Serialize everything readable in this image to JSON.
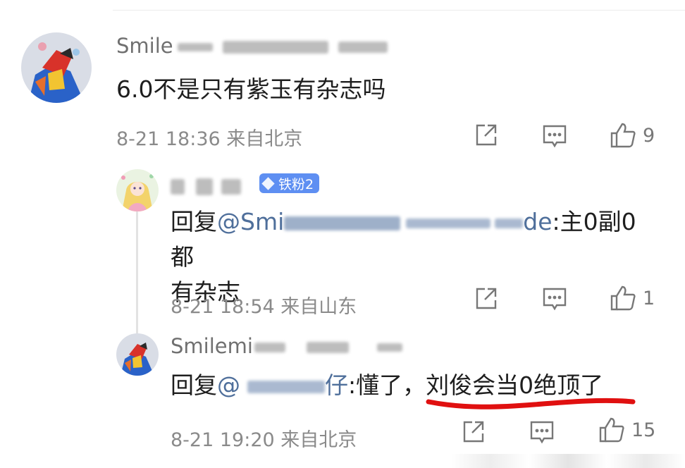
{
  "comment": {
    "author": "Smile",
    "text": "6.0不是只有紫玉有杂志吗",
    "meta": "8-21 18:36 来自北京",
    "like_count": "9"
  },
  "reply1": {
    "badge": "铁粉2",
    "reply_prefix": "回复",
    "mention": "@Smi",
    "mention_tail": "de",
    "text_line1_tail": ":主0副0都",
    "text_line2": "有杂志",
    "meta": "8-21 18:54 来自山东",
    "like_count": "1"
  },
  "reply2": {
    "author": "Smilemi",
    "reply_prefix": "回复",
    "mention": "@",
    "mention_tail": "仔",
    "text_a": ":懂了，",
    "text_highlight": "刘俊会当0绝顶了",
    "meta": "8-21 19:20 来自北京",
    "like_count": "15"
  },
  "colors": {
    "mention": "#4f6f9b",
    "badge": "#5e8ff2",
    "underline": "#e01010"
  },
  "icons": [
    "share-icon",
    "comment-icon",
    "like-icon",
    "fan-badge-diamond-icon"
  ]
}
